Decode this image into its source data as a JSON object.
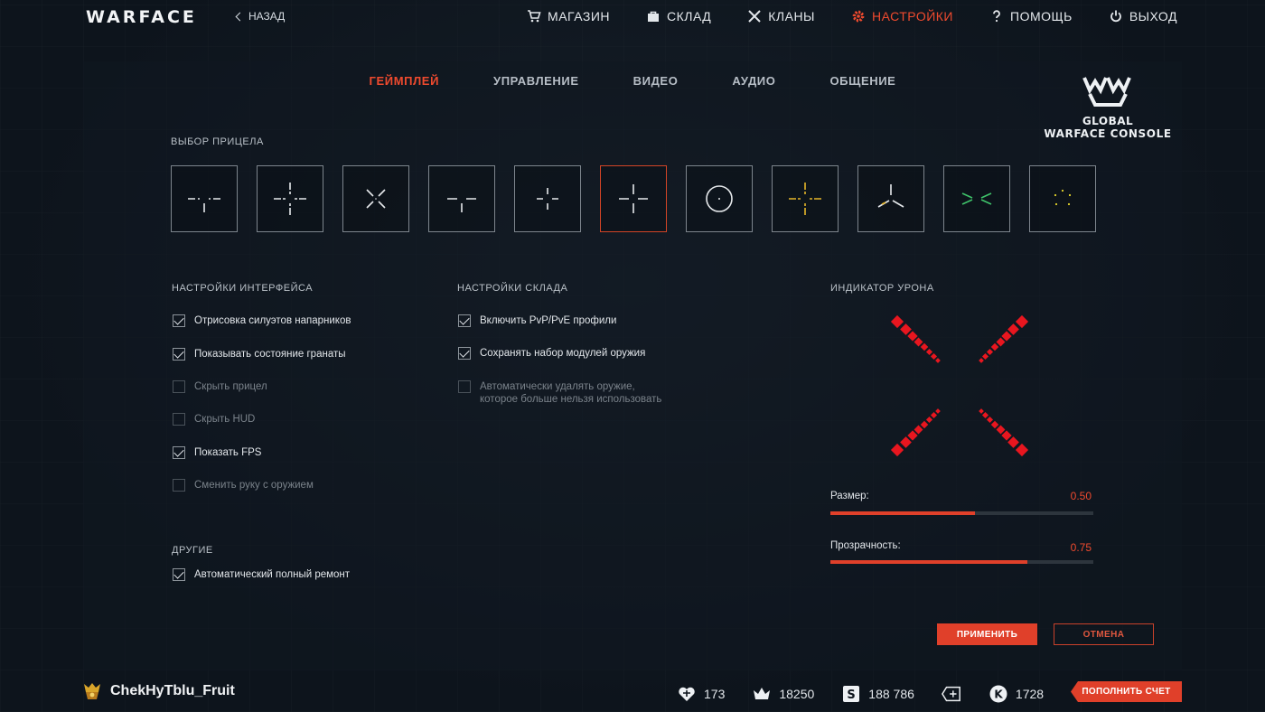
{
  "header": {
    "logo": "WARFACE",
    "back_label": "НАЗАД",
    "nav": [
      {
        "label": "МАГАЗИН",
        "icon": "cart-icon",
        "active": false
      },
      {
        "label": "СКЛАД",
        "icon": "bag-icon",
        "active": false
      },
      {
        "label": "КЛАНЫ",
        "icon": "crossed-swords-icon",
        "active": false
      },
      {
        "label": "НАСТРОЙКИ",
        "icon": "gear-icon",
        "active": true
      },
      {
        "label": "ПОМОЩЬ",
        "icon": "question-icon",
        "active": false
      },
      {
        "label": "ВЫХОД",
        "icon": "power-icon",
        "active": false
      }
    ]
  },
  "tabs": [
    {
      "label": "ГЕЙМПЛЕЙ",
      "active": true
    },
    {
      "label": "УПРАВЛЕНИЕ",
      "active": false
    },
    {
      "label": "ВИДЕО",
      "active": false
    },
    {
      "label": "АУДИО",
      "active": false
    },
    {
      "label": "ОБЩЕНИЕ",
      "active": false
    }
  ],
  "badge": {
    "line1": "GLOBAL",
    "line2": "WARFACE CONSOLE"
  },
  "crosshair": {
    "title": "ВЫБОР ПРИЦЕЛА",
    "selected_index": 5,
    "options": [
      "crosshair-1-icon",
      "crosshair-2-icon",
      "crosshair-3-icon",
      "crosshair-4-icon",
      "crosshair-5-icon",
      "crosshair-6-icon",
      "crosshair-circle-icon",
      "crosshair-yellow-icon",
      "crosshair-tri-icon",
      "crosshair-green-icon",
      "crosshair-dots-icon"
    ]
  },
  "interface": {
    "title": "НАСТРОЙКИ ИНТЕРФЕЙСА",
    "items": [
      {
        "label": "Отрисовка силуэтов напарников",
        "checked": true,
        "disabled": false
      },
      {
        "label": "Показывать состояние гранаты",
        "checked": true,
        "disabled": false
      },
      {
        "label": "Скрыть прицел",
        "checked": false,
        "disabled": true
      },
      {
        "label": "Скрыть HUD",
        "checked": false,
        "disabled": true
      },
      {
        "label": "Показать FPS",
        "checked": true,
        "disabled": false
      },
      {
        "label": "Сменить руку с оружием",
        "checked": false,
        "disabled": true
      }
    ]
  },
  "other": {
    "title": "ДРУГИЕ",
    "items": [
      {
        "label": "Автоматический полный ремонт",
        "checked": true,
        "disabled": false
      }
    ]
  },
  "storage": {
    "title": "НАСТРОЙКИ СКЛАДА",
    "items": [
      {
        "label": "Включить PvP/PvE профили",
        "checked": true,
        "disabled": false
      },
      {
        "label": "Сохранять набор модулей оружия",
        "checked": true,
        "disabled": false
      },
      {
        "label": "Автоматически удалять оружие,",
        "label2": "которое больше нельзя использовать",
        "checked": false,
        "disabled": true
      }
    ]
  },
  "damage_indicator": {
    "title": "ИНДИКАТОР УРОНА",
    "color": "#e8161f",
    "size": {
      "label": "Размер:",
      "value": "0.50",
      "fraction": 0.55
    },
    "opacity": {
      "label": "Прозрачность:",
      "value": "0.75",
      "fraction": 0.75
    }
  },
  "buttons": {
    "apply": "ПРИМЕНИТЬ",
    "cancel": "ОТМЕНА"
  },
  "player": {
    "name": "ChekHyTblu_Fruit",
    "icon": "rank-badge-icon"
  },
  "currencies": [
    {
      "icon": "heart-icon",
      "value": "173"
    },
    {
      "icon": "crown-icon",
      "value": "18250"
    },
    {
      "icon": "dollar-icon",
      "value": "188 786"
    },
    {
      "icon": "ticket-plus-icon",
      "value": ""
    },
    {
      "icon": "k-coin-icon",
      "value": "1728"
    }
  ],
  "topup": "ПОПОЛНИТЬ СЧЕТ",
  "colors": {
    "accent": "#e0402a",
    "background": "#0d141c",
    "text": "#d7dde3"
  }
}
